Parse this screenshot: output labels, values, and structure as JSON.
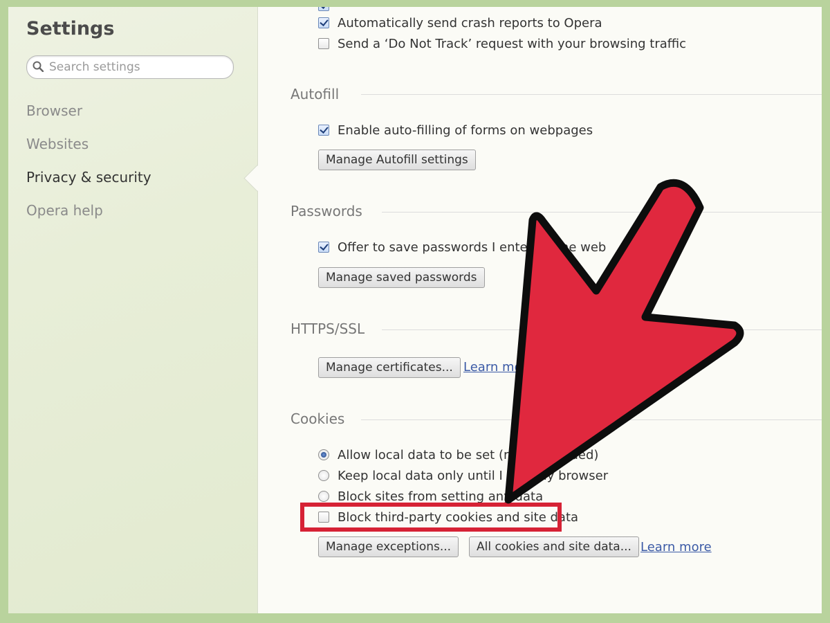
{
  "sidebar": {
    "title": "Settings",
    "search_placeholder": "Search settings",
    "items": [
      {
        "label": "Browser"
      },
      {
        "label": "Websites"
      },
      {
        "label": "Privacy & security"
      },
      {
        "label": "Opera help"
      }
    ]
  },
  "privacy": {
    "crash_reports_label": "Automatically send crash reports to Opera",
    "do_not_track_label": "Send a ‘Do Not Track’ request with your browsing traffic"
  },
  "autofill": {
    "title": "Autofill",
    "enable_label": "Enable auto-filling of forms on webpages",
    "manage_button": "Manage Autofill settings"
  },
  "passwords": {
    "title": "Passwords",
    "offer_save_label": "Offer to save passwords I enter on the web",
    "manage_button": "Manage saved passwords"
  },
  "https": {
    "title": "HTTPS/SSL",
    "manage_button": "Manage certificates...",
    "learn_more": "Learn more"
  },
  "cookies": {
    "title": "Cookies",
    "option_allow": "Allow local data to be set (recommended)",
    "option_keep": "Keep local data only until I quit my browser",
    "option_block": "Block sites from setting any data",
    "block_third_party": "Block third-party cookies and site data",
    "manage_exceptions_button": "Manage exceptions...",
    "all_cookies_button": "All cookies and site data...",
    "learn_more": "Learn more"
  },
  "colors": {
    "arrow": "#e0283e",
    "highlight": "#d62235",
    "frame": "#b9d39d"
  }
}
